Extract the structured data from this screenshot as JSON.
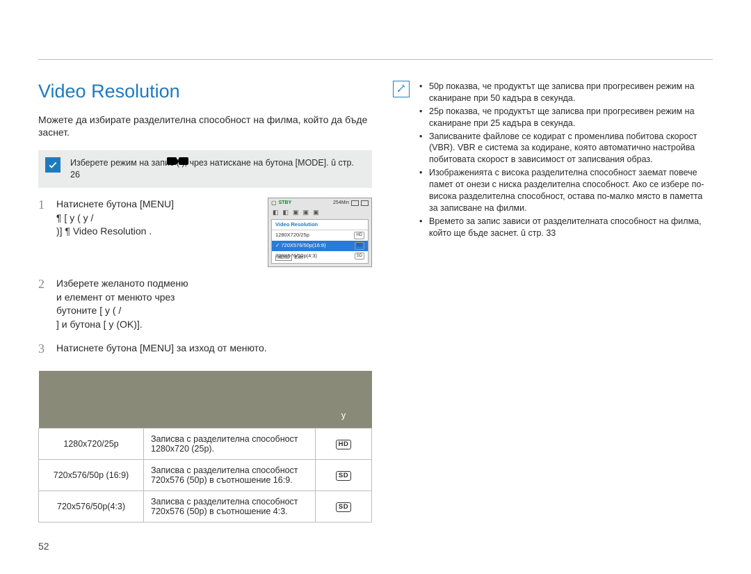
{
  "page_number": "52",
  "header_mark": "!",
  "title": "Video Resolution",
  "intro": "Можете да избирате разделителна способност на филма, който да бъде заснет.",
  "note": "Изберете режим на запис (      ), чрез натискане на бутона [MODE]. û стр. 26",
  "steps": {
    "s1_line1": "Натиснете бутона [MENU]",
    "s1_line2": "¶ [         у   (         у  /",
    "s1_line3": "           )] ¶   Video Resolution  .",
    "s2_line1": "Изберете желаното подменю",
    "s2_line2": "и елемент от менюто чрез",
    "s2_line3": "бутоните [          у    (             /",
    "s2_line4": "          ] и бутона [          у    (OK)].",
    "s3": "Натиснете бутона [MENU] за изход от менюто."
  },
  "camera_preview": {
    "status": "STBY",
    "time_remaining": "254Min",
    "menu_title": "Video Resolution",
    "options": [
      {
        "label": "1280X720/25p",
        "tag": "HD",
        "selected": false
      },
      {
        "label": "720X576/50p(16:9)",
        "tag": "SD",
        "selected": true
      },
      {
        "label": "720X576/50p(4:3)",
        "tag": "SD",
        "selected": false
      }
    ],
    "footer_btn": "MENU",
    "footer_label": "Exit"
  },
  "table": {
    "header_blank1": "",
    "header_blank2": "",
    "header_y": "у",
    "rows": [
      {
        "name": "1280x720/25p",
        "desc": "Записва с разделителна способност 1280x720 (25p).",
        "badge": "HD"
      },
      {
        "name": "720x576/50p (16:9)",
        "desc": "Записва с разделителна способност 720x576 (50p) в съотношение 16:9.",
        "badge": "SD"
      },
      {
        "name": "720x576/50p(4:3)",
        "desc": "Записва с разделителна способност 720x576 (50p) в съотношение 4:3.",
        "badge": "SD"
      }
    ]
  },
  "right_notes": [
    "50p показва, че продуктът ще записва при прогресивен режим на сканиране при 50 кадъра в секунда.",
    "25p показва, че продуктът ще записва при прогресивен режим на сканиране при 25 кадъра в секунда.",
    "Записваните файлове се кодират с променлива побитова скорост (VBR). VBR е система за кодиране, която автоматично настройва побитовата скорост в зависимост от записвания образ.",
    "Изображенията с висока разделителна способност заемат повече памет от онези с ниска разделителна способност. Ако се избере по-висока разделителна способност, остава по-малко място в паметта за записване на филми.",
    "Времето за запис зависи от разделителната способност на филма, който ще бъде заснет. û стр. 33"
  ]
}
